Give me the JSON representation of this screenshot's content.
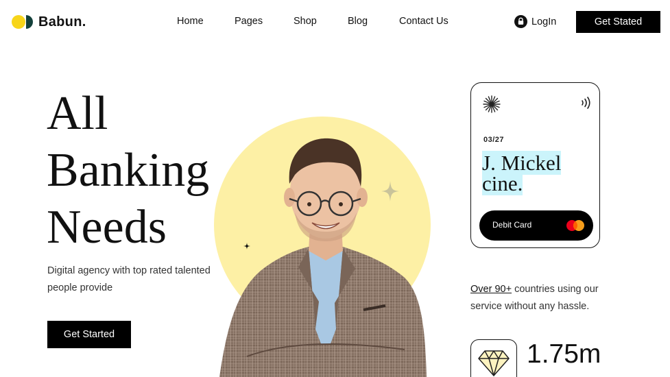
{
  "brand": {
    "name": "Babun."
  },
  "nav": {
    "items": [
      {
        "label": "Home"
      },
      {
        "label": "Pages"
      },
      {
        "label": "Shop"
      },
      {
        "label": "Blog"
      },
      {
        "label": "Contact Us"
      }
    ],
    "login_label": "LogIn",
    "cta_label": "Get Stated"
  },
  "hero": {
    "title_lines": [
      "All",
      "Banking",
      "Needs"
    ],
    "subtitle": "Digital agency with top rated talented people provide",
    "cta_label": "Get Started"
  },
  "card": {
    "expiry": "03/27",
    "name_line1": "J. Mickel",
    "name_line2": "cine.",
    "type_label": "Debit Card"
  },
  "stats": {
    "countries_highlight": "Over 90+",
    "countries_text": " countries using our service without any hassle.",
    "value": "1.75m"
  },
  "icons": {
    "logo": "two-circles-logo-icon",
    "login": "lock-icon",
    "card_top_left": "starburst-icon",
    "card_top_right": "contactless-icon",
    "card_brand": "mastercard-icon",
    "stat": "diamond-icon",
    "decor_big": "sparkle-icon",
    "decor_small": "small-sparkle-icon"
  },
  "colors": {
    "logo_yellow": "#f7d51a",
    "logo_green": "#13403a",
    "hero_circle": "#fdf0a5",
    "name_highlight": "#cbf4fb",
    "button_bg": "#000000"
  }
}
